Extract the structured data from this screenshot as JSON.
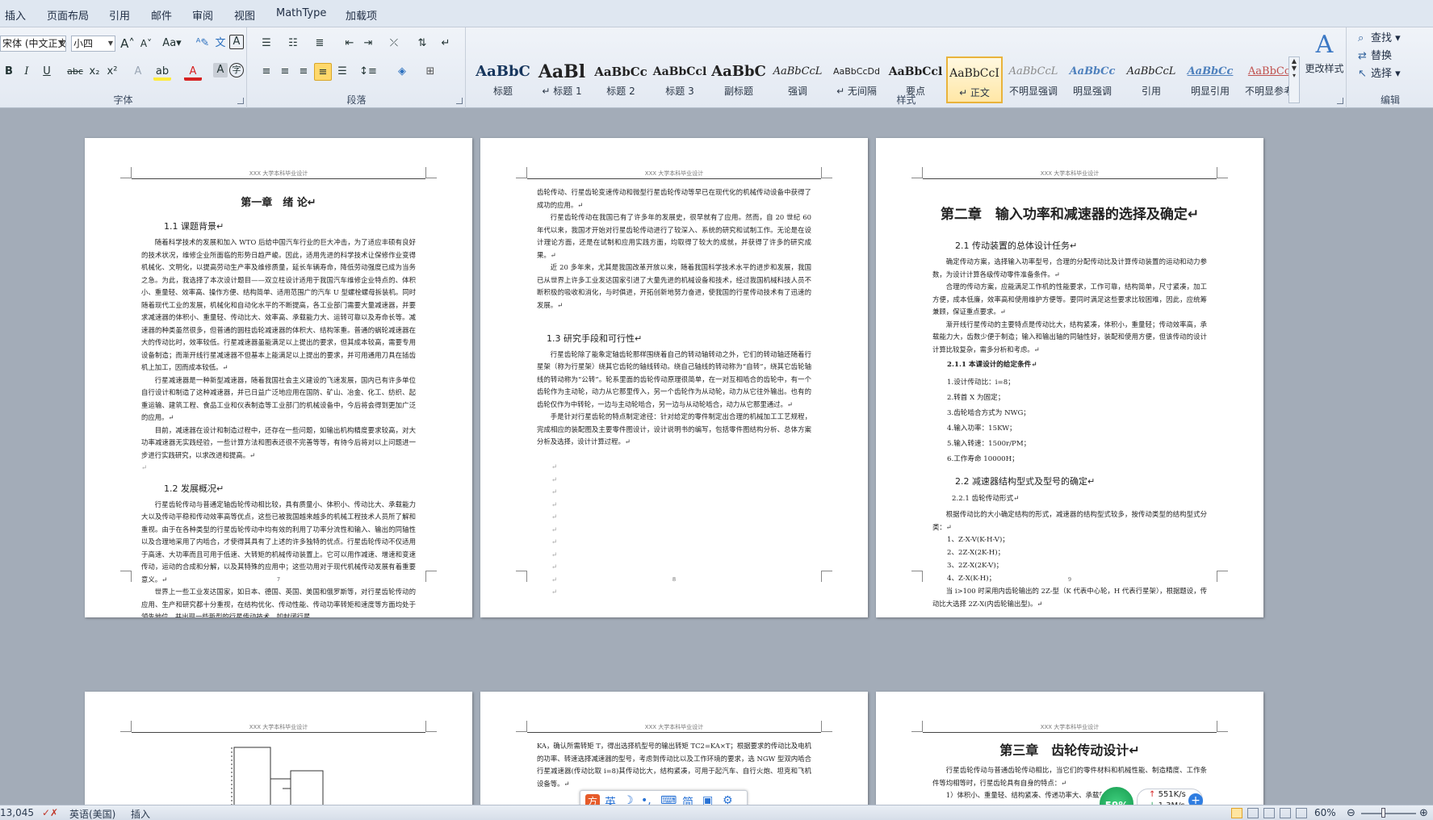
{
  "tabs": [
    "插入",
    "页面布局",
    "引用",
    "邮件",
    "审阅",
    "视图",
    "MathType",
    "加载项"
  ],
  "font_group": {
    "label": "字体",
    "font_name": "宋体 (中文正文",
    "font_size": "小四",
    "grow": "A",
    "shrink": "A",
    "case": "Aa",
    "bold": "B",
    "italic": "I",
    "underline": "U",
    "strike": "abc",
    "subscript": "x₂",
    "superscript": "x²",
    "highlight": "ab",
    "font_color": "A"
  },
  "paragraph_group": {
    "label": "段落"
  },
  "styles_group": {
    "label": "样式",
    "styles": [
      {
        "sample": "AaBbC",
        "name": "标题"
      },
      {
        "sample": "AaBl",
        "name": "↵ 标题 1"
      },
      {
        "sample": "AaBbCc",
        "name": "标题 2"
      },
      {
        "sample": "AaBbCcl",
        "name": "标题 3"
      },
      {
        "sample": "AaBbC",
        "name": "副标题"
      },
      {
        "sample": "AaBbCcL",
        "name": "强调"
      },
      {
        "sample": "AaBbCcDd",
        "name": "↵ 无间隔"
      },
      {
        "sample": "AaBbCcl",
        "name": "要点"
      },
      {
        "sample": "AaBbCcI",
        "name": "↵ 正文"
      },
      {
        "sample": "AaBbCcL",
        "name": "不明显强调"
      },
      {
        "sample": "AaBbCc",
        "name": "明显强调"
      },
      {
        "sample": "AaBbCcL",
        "name": "引用"
      },
      {
        "sample": "AaBbCc",
        "name": "明显引用"
      },
      {
        "sample": "AaBbCc",
        "name": "不明显参考"
      }
    ],
    "change_styles": "更改样式"
  },
  "editing_group": {
    "label": "编辑",
    "find": "查找",
    "replace": "替换",
    "select": "选择"
  },
  "pages": [
    {
      "header": "XXX 大学本科毕业设计",
      "number": "7",
      "chapter": "第一章　绪 论↵",
      "sec1": "1.1 课题背景↵",
      "p1": "随着科学技术的发展和加入 WTO 后给中国汽车行业的巨大冲击，为了适应丰硕有良好的技术状况，维修企业所面临的形势日趋严峻。因此，适用先进的科学技术让保修作业变得机械化、文明化，以提高劳动生产率及维修质量，延长车辆寿命，降低劳动强度已成为当务之急。为此，我选择了本次设计题目——双立柱设计适用于我国汽车维修企业特点的、体积小、重量轻、效率高、操作方便、结构简单、适用范围广的汽车 U 型螺栓螺母拆装机。同时随着现代工业的发展，机械化和自动化水平的不断提高，各工业部门需要大量减速器，并要求减速器的体积小、重量轻、传动比大、效率高、承载能力大、运转可靠以及寿命长等。减速器的种类虽然很多，但普通的圆柱齿轮减速器的体积大、结构笨重。普通的蜗轮减速器在大的传动比时，效率较低。行星减速器虽能满足以上提出的要求，但其成本较高，需要专用设备制造；而渐开线行星减速器不但基本上能满足以上提出的要求，并可用通用刀具在插齿机上加工，因而成本较低。↵",
      "p2": "行星减速器是一种新型减速器，随着我国社会主义建设的飞速发展，国内已有许多单位自行设计和制造了这种减速器，并已日益广泛地应用在国防、矿山、冶金、化工、纺织、起重运输、建筑工程、食品工业和仪表制造等工业部门的机械设备中，今后将会得到更加广泛的应用。↵",
      "p3": "目前，减速器在设计和制造过程中，还存在一些问题，如输出机构精度要求较高，对大功率减速器无实践经验，一些计算方法和图表还很不完善等等，有待今后将对以上问题进一步进行实践研究，以求改进和提高。↵",
      "sec2": "1.2 发展概况↵",
      "p4": "行星齿轮传动与普通定轴齿轮传动相比较，具有质量小、体积小、传动比大、承载能力大以及传动平稳和传动效率高等优点，这些已被我国越来越多的机械工程技术人员所了解和重视。由于在各种类型的行星齿轮传动中均有效的利用了功率分流性和输入、输出的同轴性以及合理地采用了内啮合，才使得其具有了上述的许多独特的优点。行星齿轮传动不仅适用于高速、大功率而且可用于低速、大转矩的机械传动装置上。它可以用作减速、增速和变速传动，运动的合成和分解，以及其特殊的应用中；这些功用对于现代机械传动发展有着重要意义。↵",
      "p5": "世界上一些工业发达国家，如日本、德国、英国、美国和俄罗斯等，对行星齿轮传动的应用、生产和研究都十分重视，在结构优化、传动性能、传动功率转矩和速度等方面均处于领先地位，并出现一些新型的行星传动技术，如封闭行星"
    },
    {
      "header": "XXX 大学本科毕业设计",
      "number": "8",
      "p1": "齿轮传动、行星齿轮变速传动和微型行星齿轮传动等早已在现代化的机械传动设备中获得了成功的应用。↵",
      "p2": "行星齿轮传动在我国已有了许多年的发展史，很早就有了应用。然而，自 20 世纪 60 年代以来，我国才开始对行星齿轮传动进行了较深入、系统的研究和试制工作。无论是在设计理论方面，还是在试制和应用实践方面，均取得了较大的成就，并获得了许多的研究成果。↵",
      "p3": "近 20 多年来，尤其是我国改革开放以来，随着我国科学技术水平的进步和发展，我国已从世界上许多工业发达国家引进了大量先进的机械设备和技术，经过我国机械科技人员不断积极的吸收和消化，与时俱进，开拓创新地努力奋进，使我国的行星传动技术有了迅速的发展。↵",
      "sec": "1.3 研究手段和可行性↵",
      "p4": "行星齿轮除了能象定轴齿轮那样围绕着自己的转动轴转动之外，它们的转动轴还随着行星架（称为行星架）绕其它齿轮的轴线转动。绕自己轴线的转动称为“自转”，绕其它齿轮轴线的转动称为“公转”。轮系里面的齿轮传动原理很简单，在一对互相啮合的齿轮中，有一个齿轮作为主动轮，动力从它那里传入，另一个齿轮作为从动轮，动力从它往外输出。也有的齿轮仅作为中转轮，一边与主动轮啮合，另一边与从动轮啮合，动力从它那里通过。↵",
      "p5": "手是针对行星齿轮的特点制定途径：针对给定的零件制定出合理的机械加工工艺规程，完成相应的装配图及主要零件图设计，设计说明书的编写，包括零件图结构分析、总体方案分析及选择，设计计算过程。↵"
    },
    {
      "header": "XXX 大学本科毕业设计",
      "number": "9",
      "chapter": "第二章　输入功率和减速器的选择及确定↵",
      "sec": "2.1 传动装置的总体设计任务↵",
      "p1": "确定传动方案，选择输入功率型号，合理的分配传动比及计算传动装置的运动和动力参数，为设计计算各级传动零件准备条件。↵",
      "p2": "合理的传动方案，应能满足工作机的性能要求，工作可靠，结构简单，尺寸紧凑，加工方便，成本低廉，效率高和使用维护方便等。要同时满足这些要求比较困难，因此，应统筹兼顾，保证重点要求。↵",
      "p3": "渐开线行星传动的主要特点是传动比大，结构紧凑，体积小，重量轻；传动效率高，承载能力大，齿数少便于制造；输入和输出轴的同轴性好，装配和使用方便，但该传动的设计计算比较复杂，需多分析和考虑。↵",
      "sub": "2.1.1 本课设计的给定条件↵",
      "items": [
        "1.设计传动比：i=8；",
        "2.转首 X 为固定；",
        "3.齿轮啮合方式为 NWG；",
        "4.输入功率：15KW；",
        "5.输入转速：1500r/PM；",
        "6.工作寿命 10000H；"
      ],
      "sec2": "2.2 减速器结构型式及型号的确定↵",
      "sub2": "2.2.1 齿轮传动形式↵",
      "p4": "根据传动比的大小确定结构的形式，减速器的结构型式较多，按传动类型的结构型式分类：↵",
      "types": [
        "1、Z-X-V(K-H-V)；",
        "2、2Z-X(2K-H)；",
        "3、2Z-X(2K-V)；",
        "4、Z-X(K-H)；"
      ],
      "p5": "当 i>100 时采用内齿轮输出的 2Z-型（K 代表中心轮，H 代表行星架），根据题设，传动比大选择 2Z-X(内齿轮输出型)。↵"
    },
    {
      "header": "XXX 大学本科毕业设计"
    },
    {
      "header": "XXX 大学本科毕业设计",
      "p1": "KA，确认所需转矩 T，得出选择机型号的输出转矩 TC2=KA×T；根据要求的传动比及电机的功率、转速选择减速器的型号，考虑到传动比以及工作环境的要求，选 NGW 型双内啮合行星减速器(传动比取 i=8)其传动比大，结构紧凑，可用于起汽车、自行火炮、坦克和飞机设备等。↵"
    },
    {
      "header": "XXX 大学本科毕业设计",
      "chapter": "第三章　齿轮传动设计↵",
      "p1": "行星齿轮传动与普通齿轮传动相比，当它们的零件材料和机械性能、制造精度、工作条件等均相等时，行星齿轮具有自身的特点：↵",
      "p2": "1）体积小、重量轻、结构紧凑、传递功率大、承载能力高；"
    }
  ],
  "status": {
    "words": "13,045",
    "language": "英语(美国)",
    "mode": "插入",
    "zoom": "60%"
  },
  "ime": {
    "logo": "方",
    "lang": "英",
    "moon": "☽",
    "punct": "•,",
    "keyboard": "⌨",
    "simp": "简",
    "skin": "▣",
    "settings": "⚙"
  },
  "network": {
    "percent": "59%",
    "up": "551K/s",
    "down": "1.3M/s"
  },
  "colors": {
    "accent": "#e9b33b",
    "highlight": "#ffeb3b",
    "font_color": "#d62222"
  }
}
